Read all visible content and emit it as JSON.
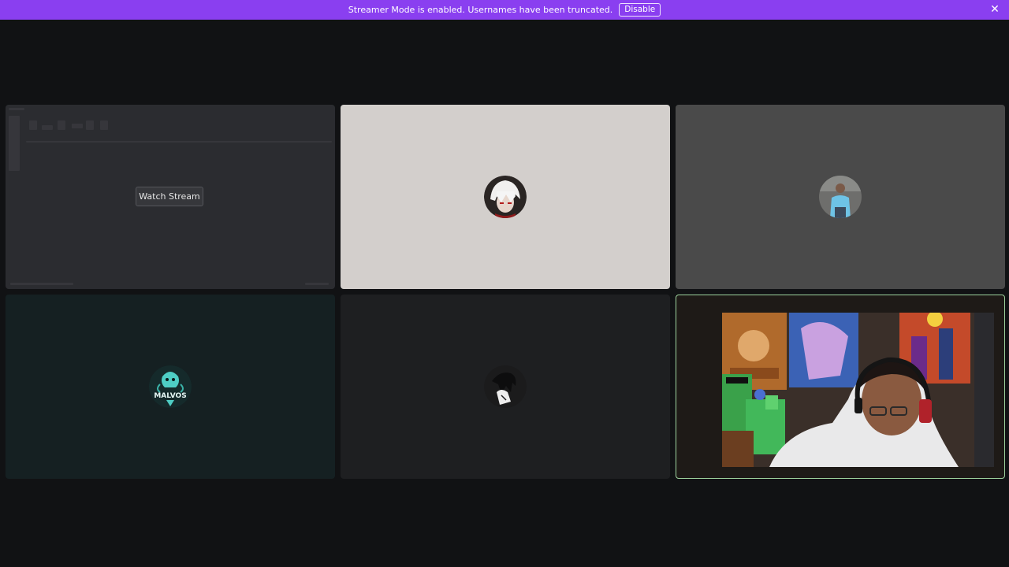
{
  "banner": {
    "message": "Streamer Mode is enabled. Usernames have been truncated.",
    "disable_label": "Disable",
    "close_icon": "close-icon",
    "color": "#8a3ff0"
  },
  "tiles": [
    {
      "id": "stream-tile",
      "watch_label": "Watch Stream"
    },
    {
      "id": "participant-2",
      "avatar_icon": "white-hair-anime-avatar"
    },
    {
      "id": "participant-3",
      "avatar_icon": "person-photo-avatar"
    },
    {
      "id": "participant-4",
      "avatar_icon": "malvos-logo-avatar",
      "avatar_text": "MALVOS"
    },
    {
      "id": "participant-5",
      "avatar_icon": "dark-anime-avatar"
    },
    {
      "id": "participant-6",
      "speaking": true,
      "speaking_color": "#9ed39e"
    }
  ]
}
